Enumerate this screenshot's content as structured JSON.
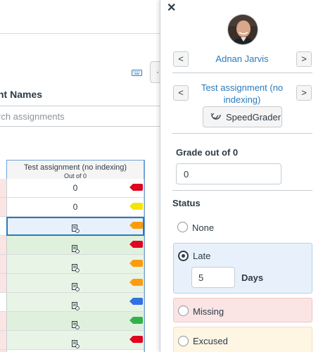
{
  "gradebook": {
    "column_names_label": "nt Names",
    "search_placeholder": "rch assignments",
    "settings_glyph": "·",
    "assignment_column": {
      "title": "Test assignment (no indexing)",
      "subtitle": "Out of 0"
    },
    "rows": [
      {
        "value": "0",
        "kind": "text",
        "flag_color": "#e0061f",
        "row_bg": "#ffffff",
        "left_bg": "#fbe4e4",
        "partial": true
      },
      {
        "value": "0",
        "kind": "text",
        "flag_color": "#f5e506",
        "row_bg": "#ffffff",
        "left_bg": "#fbe4e4",
        "partial": false
      },
      {
        "value": "",
        "kind": "submission-icon",
        "flag_color": "#fc9c0c",
        "row_bg": "#e8f1fb",
        "left_bg": "#ffffff",
        "selected": true
      },
      {
        "value": "",
        "kind": "submission-icon",
        "flag_color": "#e0061f",
        "row_bg": "#dff1dd",
        "left_bg": "#fbe4e4"
      },
      {
        "value": "",
        "kind": "submission-icon",
        "flag_color": "#fc9c0c",
        "row_bg": "#e8f4e6",
        "left_bg": "#fbe4e4"
      },
      {
        "value": "",
        "kind": "submission-icon",
        "flag_color": "#fc9c0c",
        "row_bg": "#e8f4e6",
        "left_bg": "#fbe4e4"
      },
      {
        "value": "",
        "kind": "submission-icon",
        "flag_color": "#3170e6",
        "row_bg": "#e8f4e6",
        "left_bg": "#ffffff"
      },
      {
        "value": "",
        "kind": "submission-icon",
        "flag_color": "#34b24a",
        "row_bg": "#dff1dd",
        "left_bg": "#fbe4e4"
      },
      {
        "value": "",
        "kind": "submission-icon",
        "flag_color": "#e0061f",
        "row_bg": "#e8f4e6",
        "left_bg": "#fbe4e4"
      },
      {
        "value": "",
        "kind": "submission-icon",
        "flag_color": "",
        "row_bg": "#ffffff",
        "left_bg": "#fbe4e4"
      }
    ]
  },
  "tray": {
    "close_glyph": "✕",
    "student_name": "Adnan Jarvis",
    "prev_glyph": "<",
    "next_glyph": ">",
    "assignment_name": "Test assignment (no indexing)",
    "speedgrader_label": "SpeedGrader",
    "grade_label": "Grade out of 0",
    "grade_value": "0",
    "status_label": "Status",
    "status_options": [
      {
        "label": "None",
        "checked": false,
        "bg": "#ffffff",
        "border": ""
      },
      {
        "label": "Late",
        "checked": true,
        "bg": "#e8f1fb",
        "border": "#b5d0ea"
      },
      {
        "label": "Missing",
        "checked": false,
        "bg": "#fbe4e4",
        "border": "#f0c6c6"
      },
      {
        "label": "Excused",
        "checked": false,
        "bg": "#fef5e3",
        "border": "#f2dfb9"
      }
    ],
    "late_days_value": "5",
    "late_days_label": "Days"
  },
  "colors": {
    "link_blue": "#2b7abc",
    "text": "#2d3b45",
    "border": "#c7cdd1"
  }
}
